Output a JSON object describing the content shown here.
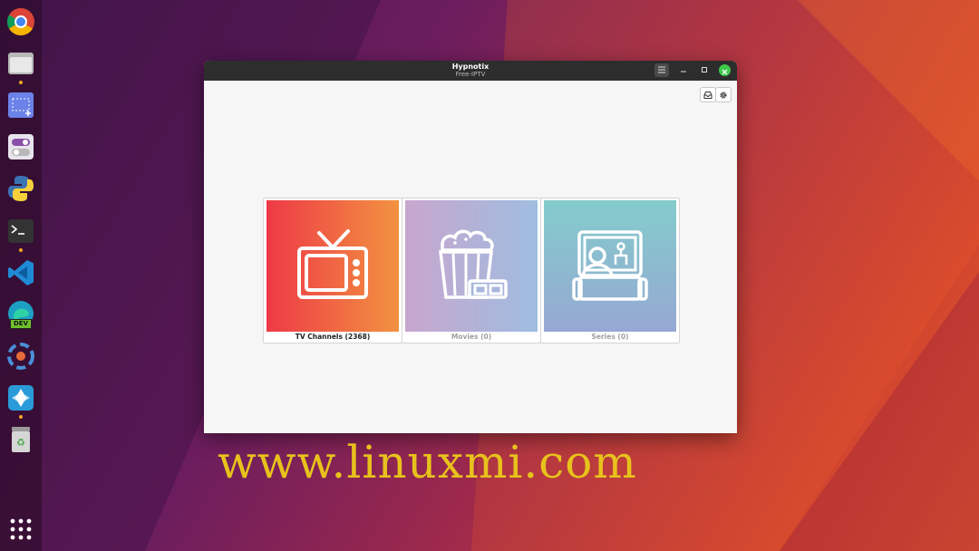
{
  "window": {
    "title": "Hypnotix",
    "subtitle": "Free-IPTV"
  },
  "cards": [
    {
      "label": "TV Channels (2368)",
      "enabled": true
    },
    {
      "label": "Movies (0)",
      "enabled": false
    },
    {
      "label": "Series (0)",
      "enabled": false
    }
  ],
  "dock": {
    "items": [
      "chrome-icon",
      "files-icon",
      "screenshot-icon",
      "tweaks-icon",
      "python-icon",
      "terminal-icon",
      "vscode-icon",
      "edge-dev-icon",
      "app-icon",
      "hypnotix-icon",
      "trash-icon"
    ],
    "edge_badge": "DEV"
  },
  "watermark": "www.linuxmi.com",
  "colors": {
    "titlebar": "#2d2d2d",
    "close": "#3ec94a",
    "watermark": "#e8c21c",
    "tv_gradient": [
      "#ee3a47",
      "#f29240"
    ],
    "movies_gradient": [
      "#c8a6ce",
      "#9fbde0"
    ],
    "series_gradient": [
      "#84cccc",
      "#96a8d2"
    ]
  }
}
